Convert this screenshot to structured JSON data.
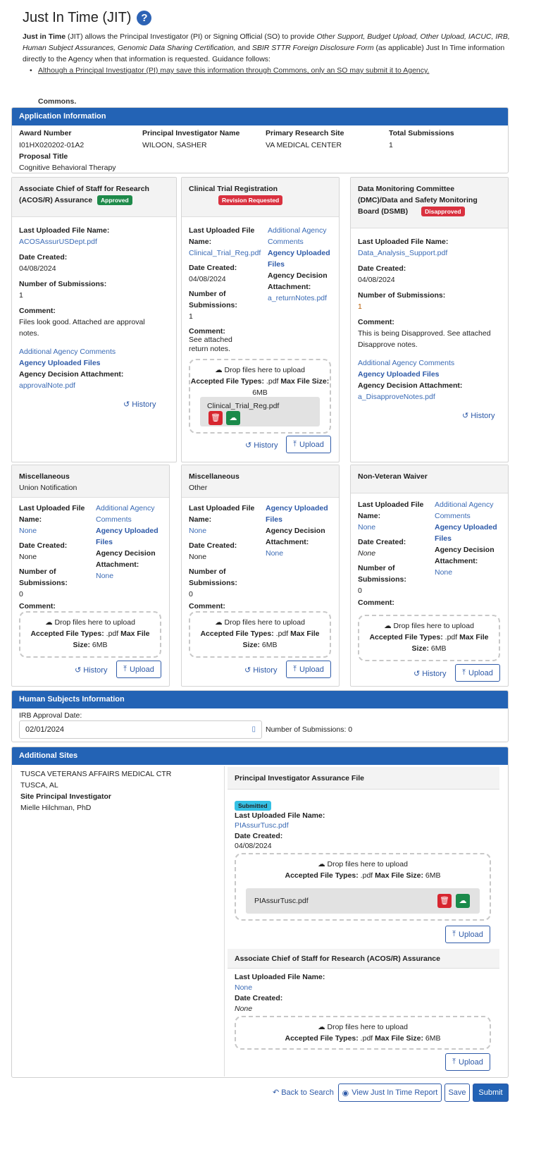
{
  "header": {
    "title": "Just In Time (JIT)",
    "help_icon": "question-circle-icon"
  },
  "intro": {
    "p1_bold": "Just in Time",
    "p1_a": " (JIT) allows the Principal Investigator (PI) or Signing Official (SO) to provide ",
    "p1_i1": "Other Support, Budget Upload, Other Upload, IACUC, IRB, Human Subject Assurances, Genomic Data Sharing Certification,",
    "p1_b": " and ",
    "p1_i2": "SBIR STTR Foreign Disclosure Form",
    "p1_c": " (as applicable) Just In Time information directly to the Agency when that information is requested.  Guidance follows:",
    "bullet": "Although a Principal Investigator (PI) may save this information through Commons, only an SO may submit it to Agency.",
    "commons": "Commons."
  },
  "app_info": {
    "heading": "Application Information",
    "award_label": "Award Number",
    "award": "I01HX020202-01A2",
    "pi_label": "Principal Investigator Name",
    "pi": "WILOON, SASHER",
    "site_label": "Primary Research Site",
    "site": "VA MEDICAL CENTER",
    "subs_label": "Total Submissions",
    "subs": "1",
    "proposal_label": "Proposal Title",
    "proposal": "Cognitive Behavioral Therapy"
  },
  "cards": {
    "acos": {
      "title": "Associate Chief of Staff for Research (ACOS/R) Assurance",
      "badge": "Approved",
      "file_label": "Last Uploaded File Name:",
      "file": "ACOSAssurUSDept.pdf",
      "date_label": "Date Created:",
      "date": "04/08/2024",
      "subs_label": "Number of Submissions:",
      "subs": "1",
      "comment_label": "Comment:",
      "comment": "Files look good. Attached are approval notes.",
      "aac": "Additional Agency Comments",
      "auf": "Agency Uploaded Files",
      "ada": "Agency Decision Attachment:",
      "ada_file": "approvalNote.pdf",
      "history": "History"
    },
    "ctr": {
      "title": "Clinical Trial Registration",
      "badge": "Revision Requested",
      "file_label1": "Last Uploaded File",
      "file_label2": "Name:",
      "file": "Clinical_Trial_Reg.pdf",
      "date_label": "Date Created:",
      "date": "04/08/2024",
      "subs_label1": "Number of",
      "subs_label2": "Submissions:",
      "subs": "1",
      "comment_label": "Comment:",
      "comment": "See attached return notes.",
      "aac1": "Additional Agency",
      "aac2": "Comments",
      "auf1": "Agency Uploaded",
      "auf2": "Files",
      "ada1": "Agency Decision",
      "ada2": "Attachment:",
      "ada_file": "a_returnNotes.pdf",
      "drop": "Drop files here to upload",
      "types_label": "Accepted File Types:",
      "types": " .pdf ",
      "max_label": "Max File Size:",
      "max": " 6MB",
      "uploaded": "Clinical_Trial_Reg.pdf",
      "history": "History",
      "upload": "Upload"
    },
    "dmc": {
      "title1": "Data Monitoring Committee",
      "title2": "(DMC)/Data and Safety Monitoring",
      "title3": "Board (DSMB)",
      "badge": "Disapproved",
      "file_label": "Last Uploaded File Name:",
      "file": "Data_Analysis_Support.pdf",
      "date_label": "Date Created:",
      "date": "04/08/2024",
      "subs_label": "Number of Submissions:",
      "subs": "1",
      "comment_label": "Comment:",
      "comment": "This is being Disapproved. See attached Disapprove notes.",
      "aac": "Additional Agency Comments",
      "auf": "Agency Uploaded Files",
      "ada": "Agency Decision Attachment:",
      "ada_file": "a_DisapproveNotes.pdf",
      "history": "History"
    },
    "misc1": {
      "title": "Miscellaneous",
      "sub": "Union Notification",
      "file_label1": "Last Uploaded File",
      "file_label2": "Name:",
      "file": "None",
      "date_label": "Date Created:",
      "date": "None",
      "subs_label1": "Number of",
      "subs_label2": "Submissions:",
      "subs": "0",
      "comment_label": "Comment:",
      "aac1": "Additional Agency",
      "aac2": "Comments",
      "auf1": "Agency Uploaded",
      "auf2": "Files",
      "ada1": "Agency Decision",
      "ada2": "Attachment:",
      "ada_file": "None",
      "drop": "Drop files here to upload",
      "types_label": "Accepted File Types:",
      "types": " .pdf ",
      "max_label1": "Max File",
      "max_label2": "Size:",
      "max": " 6MB",
      "history": "History",
      "upload": "Upload"
    },
    "misc2": {
      "title": "Miscellaneous",
      "sub": "Other",
      "file_label1": "Last Uploaded File",
      "file_label2": "Name:",
      "file": "None",
      "date_label": "Date Created:",
      "date": "None",
      "subs_label1": "Number of",
      "subs_label2": "Submissions:",
      "subs": "0",
      "comment_label": "Comment:",
      "auf1": "Agency Uploaded",
      "auf2": "Files",
      "ada1": "Agency Decision",
      "ada2": "Attachment:",
      "ada_file": "None",
      "drop": "Drop files here to upload",
      "types_label": "Accepted File Types:",
      "types": " .pdf ",
      "max_label1": "Max File",
      "max_label2": "Size:",
      "max": " 6MB",
      "history": "History",
      "upload": "Upload"
    },
    "nvw": {
      "title": "Non-Veteran Waiver",
      "file_label1": "Last Uploaded File",
      "file_label2": "Name:",
      "file": "None",
      "date_label": "Date Created:",
      "date": "None",
      "subs_label1": "Number of",
      "subs_label2": "Submissions:",
      "subs": "0",
      "comment_label": "Comment:",
      "aac1": "Additional Agency",
      "aac2": "Comments",
      "auf1": "Agency Uploaded",
      "auf2": "Files",
      "ada1": "Agency Decision",
      "ada2": "Attachment:",
      "ada_file": "None",
      "drop": "Drop files here to upload",
      "types_label": "Accepted File Types:",
      "types": " .pdf ",
      "max_label1": "Max File",
      "max_label2": "Size:",
      "max": " 6MB",
      "history": "History",
      "upload": "Upload"
    }
  },
  "human": {
    "heading": "Human Subjects Information",
    "irb_label": "IRB Approval Date:",
    "irb": "02/01/2024",
    "subs": "Number of Submissions: 0"
  },
  "sites": {
    "heading": "Additional Sites",
    "name": "TUSCA VETERANS AFFAIRS MEDICAL CTR",
    "city": "TUSCA, AL",
    "spi_label": "Site Principal Investigator",
    "spi": "Mielle Hilchman, PhD",
    "pia": {
      "title": "Principal Investigator Assurance File",
      "badge": "Submitted",
      "file_label": "Last Uploaded File Name:",
      "file": "PIAssurTusc.pdf",
      "date_label": "Date Created:",
      "date": "04/08/2024",
      "drop": "Drop files here to upload",
      "types_label": "Accepted File Types:",
      "types": " .pdf ",
      "max_label": "Max File Size:",
      "max": " 6MB",
      "uploaded": "PIAssurTusc.pdf",
      "upload": "Upload"
    },
    "acos": {
      "title": "Associate Chief of Staff for Research (ACOS/R) Assurance",
      "file_label": "Last Uploaded File Name:",
      "file": "None",
      "date_label": "Date Created:",
      "date": "None",
      "drop": "Drop files here to upload",
      "types_label": "Accepted File Types:",
      "types": " .pdf ",
      "max_label": "Max File Size:",
      "max": " 6MB",
      "upload": "Upload"
    }
  },
  "footer": {
    "back": "Back to Search",
    "view": "View Just In Time Report",
    "save": "Save",
    "submit": "Submit"
  },
  "colors": {
    "primary": "#2363b5",
    "approved": "#1e8a4a",
    "danger": "#d9313f",
    "submitted": "#35c0e4"
  }
}
